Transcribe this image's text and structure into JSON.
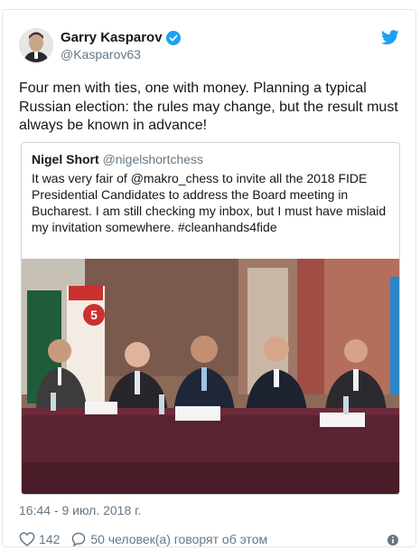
{
  "author": {
    "name": "Garry Kasparov",
    "handle": "@Kasparov63"
  },
  "tweet": {
    "text": "Four men with ties, one with money. Planning a typical Russian election: the rules may change, but the result must always be known in advance!",
    "timestamp": "16:44 - 9 июл. 2018 г."
  },
  "quoted": {
    "name": "Nigel Short",
    "handle": "@nigelshortchess",
    "text": "It was very fair of @makro_chess to invite all the 2018 FIDE Presidential Candidates to address the Board meeting in Bucharest. I am still checking my inbox, but I must have mislaid my invitation somewhere. #cleanhands4fide",
    "photo_banner_number": "5"
  },
  "actions": {
    "likes": "142",
    "replies": "50 человек(а) говорят об этом"
  },
  "colors": {
    "twitter_blue": "#1da1f2",
    "text": "#14171a",
    "secondary": "#657786"
  }
}
